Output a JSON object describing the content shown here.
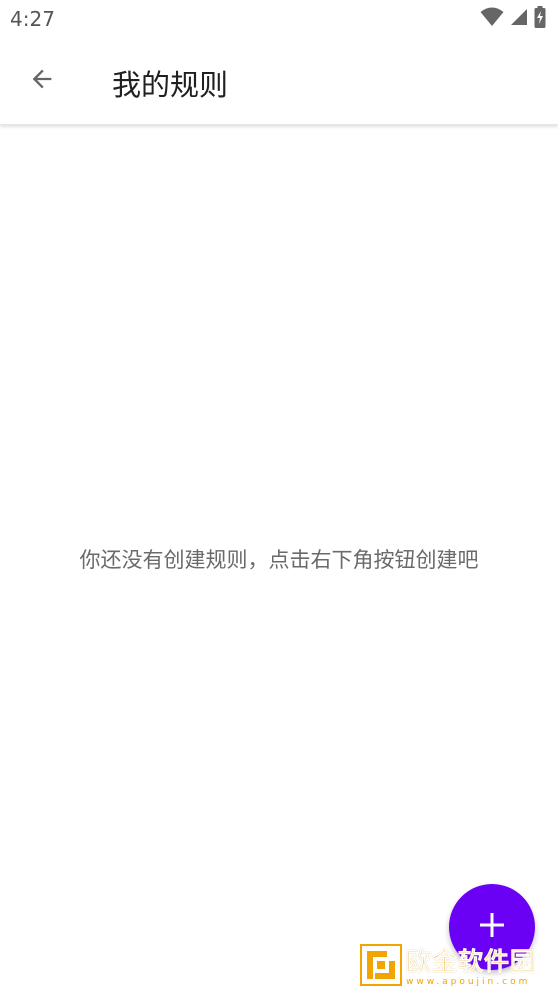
{
  "status_bar": {
    "time": "4:27",
    "icons": [
      "wifi-icon",
      "cell-signal-icon",
      "battery-charging-icon"
    ]
  },
  "app_bar": {
    "back_icon": "arrow-back-icon",
    "title": "我的规则"
  },
  "main": {
    "empty_message": "你还没有创建规则，点击右下角按钮创建吧"
  },
  "fab": {
    "icon": "plus-icon"
  },
  "watermark": {
    "title": "欧金软件园",
    "url": "www.apoujin.com"
  },
  "colors": {
    "accent": "#6a00f4",
    "watermark": "#f2a400",
    "text_primary": "#202020",
    "text_secondary": "#6a6a6a"
  }
}
